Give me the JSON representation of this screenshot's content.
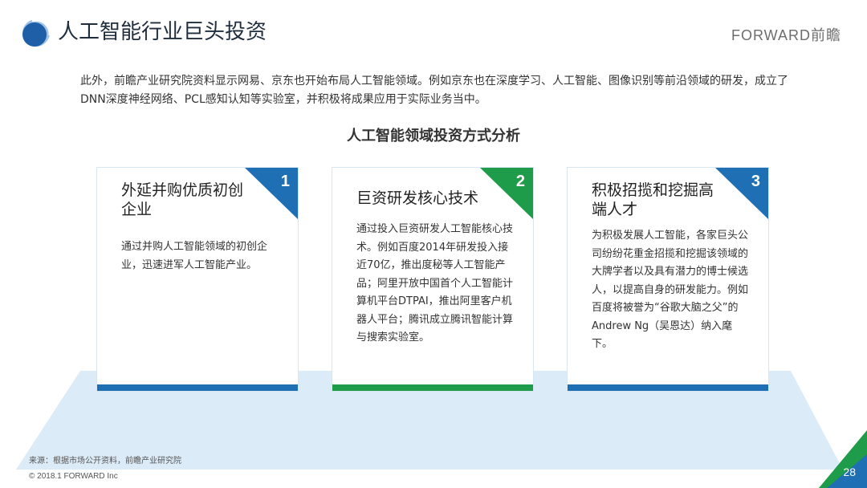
{
  "header": {
    "title": "人工智能行业巨头投资",
    "brand": "FORWARD前瞻"
  },
  "intro": "此外，前瞻产业研究院资料显示网易、京东也开始布局人工智能领域。例如京东也在深度学习、人工智能、图像识别等前沿领域的研发，成立了DNN深度神经网络、PCL感知认知等实验室，并积极将成果应用于实际业务当中。",
  "section_title": "人工智能领域投资方式分析",
  "cards": [
    {
      "number": "1",
      "heading": "外延并购优质初创企业",
      "body": "通过并购人工智能领域的初创企业，迅速进军人工智能产业。",
      "accent": "#1f6fb5"
    },
    {
      "number": "2",
      "heading": "巨资研发核心技术",
      "body": "通过投入巨资研发人工智能核心技术。例如百度2014年研发投入接近70亿，推出度秘等人工智能产品；阿里开放中国首个人工智能计算机平台DTPAI，推出阿里客户机器人平台；腾讯成立腾讯智能计算与搜索实验室。",
      "accent": "#1f9c4a"
    },
    {
      "number": "3",
      "heading": "积极招揽和挖掘高端人才",
      "body": "为积极发展人工智能，各家巨头公司纷纷花重金招揽和挖掘该领域的大牌学者以及具有潜力的博士候选人，以提高自身的研发能力。例如百度将被誉为“谷歌大脑之父”的Andrew Ng（吴恩达）纳入麾下。",
      "accent": "#1f6fb5"
    }
  ],
  "footer": {
    "source": "来源：根据市场公开资料，前瞻产业研究院",
    "copyright": "© 2018.1 FORWARD Inc",
    "page_number": "28"
  },
  "colors": {
    "blue": "#1f6fb5",
    "green": "#1f9c4a",
    "floor": "#dcebf8"
  }
}
